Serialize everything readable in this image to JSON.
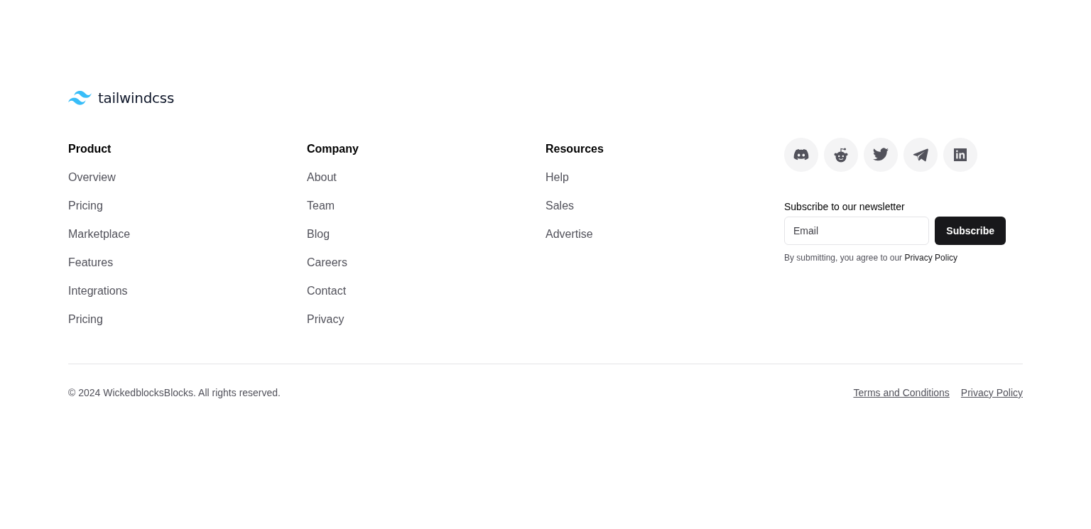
{
  "logo": {
    "wordmark": "tailwindcss"
  },
  "columns": [
    {
      "heading": "Product",
      "links": [
        "Overview",
        "Pricing",
        "Marketplace",
        "Features",
        "Integrations",
        "Pricing"
      ]
    },
    {
      "heading": "Company",
      "links": [
        "About",
        "Team",
        "Blog",
        "Careers",
        "Contact",
        "Privacy"
      ]
    },
    {
      "heading": "Resources",
      "links": [
        "Help",
        "Sales",
        "Advertise"
      ]
    }
  ],
  "social": [
    {
      "kind": "discord"
    },
    {
      "kind": "reddit"
    },
    {
      "kind": "twitter"
    },
    {
      "kind": "telegram"
    },
    {
      "kind": "linkedin"
    }
  ],
  "newsletter": {
    "label": "Subscribe to our newsletter",
    "placeholder": "Email",
    "button": "Subscribe",
    "note": "By submitting, you agree to our ",
    "note_link": "Privacy Policy"
  },
  "copyright": "© 2024 WickedblocksBlocks. All rights reserved.",
  "legal_links": [
    "Terms and Conditions",
    "Privacy Policy"
  ]
}
